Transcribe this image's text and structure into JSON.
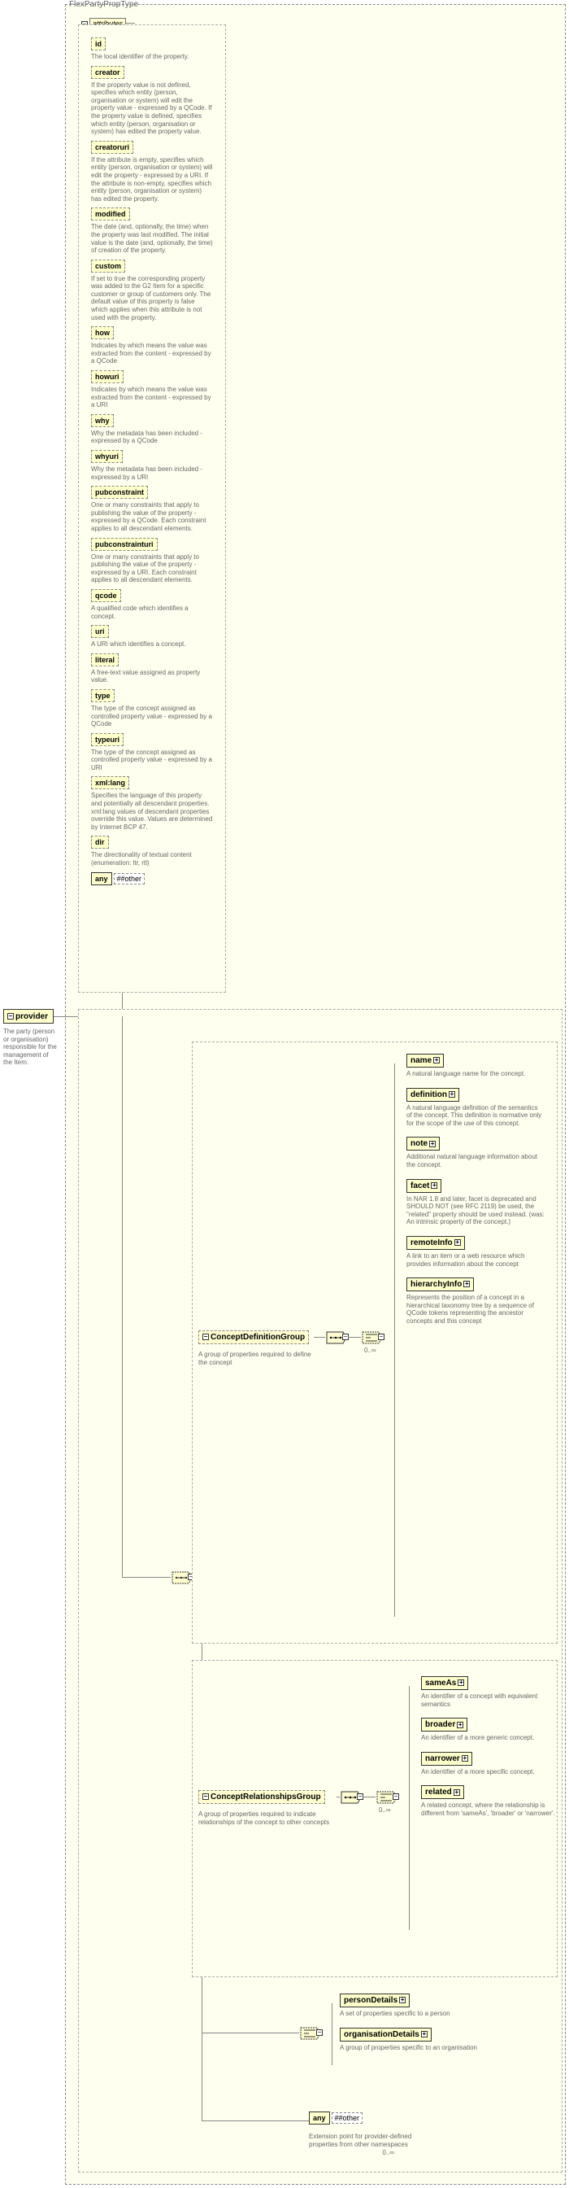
{
  "root": "FlexPartyPropType",
  "provider": {
    "name": "provider",
    "desc": "The party (person or organisation) responsible for the management of the Item."
  },
  "attributes_label": "attributes",
  "attrs": [
    {
      "k": "id",
      "d": "The local identifier of the property."
    },
    {
      "k": "creator",
      "d": "If the property value is not defined, specifies which entity (person, organisation or system) will edit the property value - expressed by a QCode. If the property value is defined, specifies which entity (person, organisation or system) has edited the property value."
    },
    {
      "k": "creatoruri",
      "d": "If the attribute is empty, specifies which entity (person, organisation or system) will edit the property - expressed by a URI. If the attribute is non-empty, specifies which entity (person, organisation or system) has edited the property."
    },
    {
      "k": "modified",
      "d": "The date (and, optionally, the time) when the property was last modified. The initial value is the date (and, optionally, the time) of creation of the property."
    },
    {
      "k": "custom",
      "d": "If set to true the corresponding property was added to the G2 Item for a specific customer or group of customers only. The default value of this property is false which applies when this attribute is not used with the property."
    },
    {
      "k": "how",
      "d": "Indicates by which means the value was extracted from the content - expressed by a QCode"
    },
    {
      "k": "howuri",
      "d": "Indicates by which means the value was extracted from the content - expressed by a URI"
    },
    {
      "k": "why",
      "d": "Why the metadata has been included - expressed by a QCode"
    },
    {
      "k": "whyuri",
      "d": "Why the metadata has been included - expressed by a URI"
    },
    {
      "k": "pubconstraint",
      "d": "One or many constraints that apply to publishing the value of the property - expressed by a QCode. Each constraint applies to all descendant elements."
    },
    {
      "k": "pubconstrainturi",
      "d": "One or many constraints that apply to publishing the value of the property - expressed by a URI. Each constraint applies to all descendant elements."
    },
    {
      "k": "qcode",
      "d": "A qualified code which identifies a concept."
    },
    {
      "k": "uri",
      "d": "A URI which identifies a concept."
    },
    {
      "k": "literal",
      "d": "A free-text value assigned as property value."
    },
    {
      "k": "type",
      "d": "The type of the concept assigned as controlled property value - expressed by a QCode"
    },
    {
      "k": "typeuri",
      "d": "The type of the concept assigned as controlled property value - expressed by a URI"
    },
    {
      "k": "xml:lang",
      "d": "Specifies the language of this property and potentially all descendant properties. xml:lang values of descendant properties override this value. Values are determined by Internet BCP 47."
    },
    {
      "k": "dir",
      "d": "The directionality of textual content (enumeration: ltr, rtl)"
    }
  ],
  "any_attr": {
    "a": "any",
    "b": "##other"
  },
  "cdg": {
    "name": "ConceptDefinitionGroup",
    "desc": "A group of properties required to define the concept",
    "card": "0..∞"
  },
  "cdg_items": [
    {
      "k": "name",
      "d": "A natural language name for the concept.",
      "dash": false,
      "plus": true
    },
    {
      "k": "definition",
      "d": "A natural language definition of the semantics of the concept. This definition is normative only for the scope of the use of this concept.",
      "dash": false,
      "plus": true
    },
    {
      "k": "note",
      "d": "Additional natural language information about the concept.",
      "dash": false,
      "plus": true
    },
    {
      "k": "facet",
      "d": "In NAR 1.8 and later, facet is deprecated and SHOULD NOT (see RFC 2119) be used, the \"related\" property should be used instead. (was: An intrinsic property of the concept.)",
      "dash": false,
      "plus": true
    },
    {
      "k": "remoteInfo",
      "d": "A link to an item or a web resource which provides information about the concept",
      "dash": false,
      "plus": true
    },
    {
      "k": "hierarchyInfo",
      "d": "Represents the position of a concept in a hierarchical taxonomy tree by a sequence of QCode tokens representing the ancestor concepts and this concept",
      "dash": false,
      "plus": true
    }
  ],
  "crg": {
    "name": "ConceptRelationshipsGroup",
    "desc": "A group of properties required to indicate relationships of the concept to other concepts",
    "card": "0..∞"
  },
  "crg_items": [
    {
      "k": "sameAs",
      "d": "An identifier of a concept with equivalent semantics",
      "plus": true
    },
    {
      "k": "broader",
      "d": "An identifier of a more generic concept.",
      "plus": true
    },
    {
      "k": "narrower",
      "d": "An identifier of a more specific concept.",
      "plus": true
    },
    {
      "k": "related",
      "d": "A related concept, where the relationship is different from 'sameAs', 'broader' or 'narrower'.",
      "plus": true
    }
  ],
  "pd": [
    {
      "k": "personDetails",
      "d": "A set of properties specific to a person",
      "plus": true
    },
    {
      "k": "organisationDetails",
      "d": "A group of properties specific to an organisation",
      "plus": true
    }
  ],
  "any_el": {
    "a": "any",
    "b": "##other",
    "d": "Extension point for provider-defined properties from other namespaces",
    "card": "0..∞"
  }
}
